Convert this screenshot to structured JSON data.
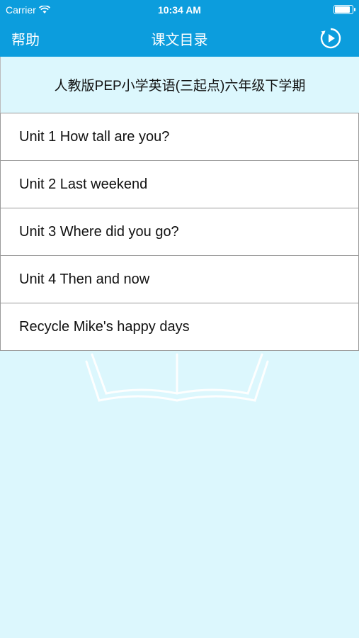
{
  "status_bar": {
    "carrier": "Carrier",
    "time": "10:34 AM"
  },
  "nav": {
    "help_label": "帮助",
    "title": "课文目录",
    "play_icon": "play-circle-icon"
  },
  "header": {
    "book_title": "人教版PEP小学英语(三起点)六年级下学期"
  },
  "units": [
    {
      "label": "Unit 1 How tall are you?"
    },
    {
      "label": "Unit 2 Last weekend"
    },
    {
      "label": "Unit 3 Where did you go?"
    },
    {
      "label": "Unit 4 Then and now"
    },
    {
      "label": "Recycle Mike's happy days"
    }
  ],
  "colors": {
    "accent": "#0c9ddd",
    "background": "#dcf7fd"
  }
}
